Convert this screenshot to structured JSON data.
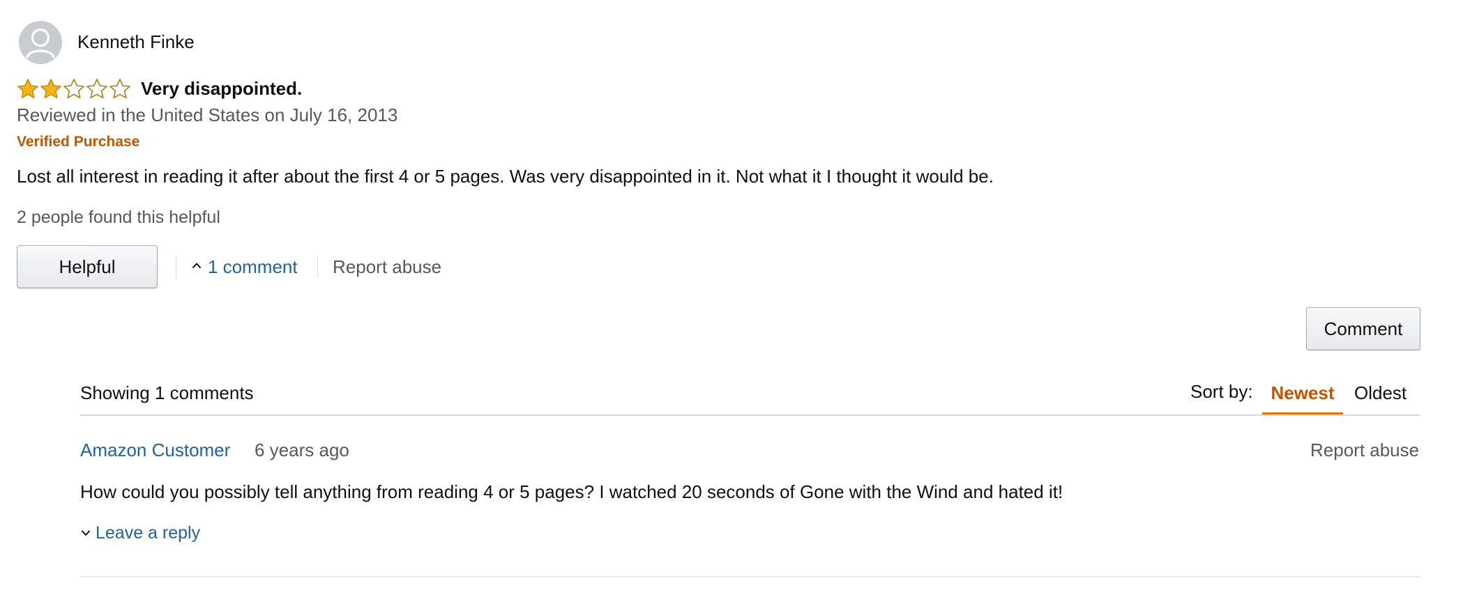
{
  "review": {
    "reviewer_name": "Kenneth Finke",
    "rating": 2,
    "max_rating": 5,
    "title": "Very disappointed.",
    "date_line": "Reviewed in the United States on July 16, 2013",
    "verified_label": "Verified Purchase",
    "body": "Lost all interest in reading it after about the first 4 or 5 pages. Was very disappointed in it. Not what it I thought it would be.",
    "helpful_count_text": "2 people found this helpful"
  },
  "actions": {
    "helpful_label": "Helpful",
    "comment_toggle_label": "1 comment",
    "report_label": "Report abuse",
    "comment_button_label": "Comment"
  },
  "comments": {
    "showing_text": "Showing 1 comments",
    "sort_label": "Sort by:",
    "sort_options": [
      "Newest",
      "Oldest"
    ],
    "sort_selected": "Newest",
    "items": [
      {
        "author": "Amazon Customer",
        "age": "6 years ago",
        "report_label": "Report abuse",
        "body": "How could you possibly tell anything from reading 4 or 5 pages? I watched 20 seconds of Gone with the Wind and hated it!",
        "reply_label": "Leave a reply"
      }
    ]
  },
  "colors": {
    "link_blue": "#2162a1",
    "orange_accent": "#c45500",
    "star_fill": "#f5b41a",
    "secondary_text": "#565959"
  },
  "icons": [
    "avatar-person-icon",
    "star-icon",
    "chevron-up-icon",
    "chevron-down-icon"
  ]
}
